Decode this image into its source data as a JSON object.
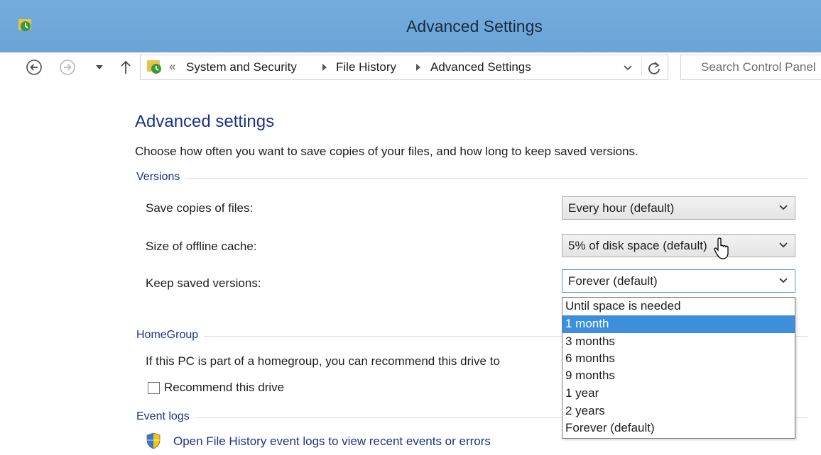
{
  "window": {
    "title": "Advanced Settings",
    "accent_color": "#6fa8dc"
  },
  "navigation": {
    "breadcrumb_prefix": "«",
    "breadcrumbs": [
      "System and Security",
      "File History",
      "Advanced Settings"
    ],
    "search_placeholder": "Search Control Panel"
  },
  "main": {
    "heading": "Advanced settings",
    "intro": "Choose how often you want to save copies of your files, and how long to keep saved versions.",
    "versions": {
      "group_label": "Versions",
      "save_copies": {
        "label": "Save copies of files:",
        "value": "Every hour (default)"
      },
      "offline_cache": {
        "label": "Size of offline cache:",
        "value": "5% of disk space (default)"
      },
      "keep_versions": {
        "label": "Keep saved versions:",
        "value": "Forever (default)",
        "options": [
          "Until space is needed",
          "1 month",
          "3 months",
          "6 months",
          "9 months",
          "1 year",
          "2 years",
          "Forever (default)"
        ],
        "highlighted_option": "1 month"
      }
    },
    "homegroup": {
      "group_label": "HomeGroup",
      "text": "If this PC is part of a homegroup, you can recommend this drive to",
      "checkbox_label": "Recommend this drive",
      "checkbox_checked": false
    },
    "event_logs": {
      "group_label": "Event logs",
      "link_text": "Open File History event logs to view recent events or errors"
    }
  },
  "icons": {
    "title": "file-history-icon",
    "back": "back-arrow-icon",
    "forward": "forward-arrow-icon",
    "recent": "chevron-down-icon",
    "up": "up-arrow-icon",
    "refresh": "refresh-icon",
    "shield": "shield-icon",
    "cursor": "mouse-pointer-icon"
  }
}
